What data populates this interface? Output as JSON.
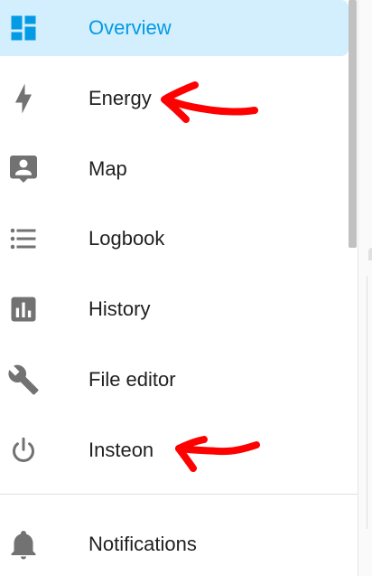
{
  "sidebar": {
    "items": [
      {
        "label": "Overview",
        "icon": "dashboard-icon",
        "active": true
      },
      {
        "label": "Energy",
        "icon": "lightning-bolt-icon"
      },
      {
        "label": "Map",
        "icon": "account-box-icon"
      },
      {
        "label": "Logbook",
        "icon": "format-list-bulleted-icon"
      },
      {
        "label": "History",
        "icon": "chart-box-icon"
      },
      {
        "label": "File editor",
        "icon": "wrench-icon"
      },
      {
        "label": "Insteon",
        "icon": "power-icon"
      },
      {
        "label": "Notifications",
        "icon": "bell-icon"
      }
    ]
  },
  "colors": {
    "accent": "#039be5",
    "active_background": "#d3eefc",
    "icon": "#727272",
    "text": "#212121",
    "annotation": "#ff0000"
  }
}
